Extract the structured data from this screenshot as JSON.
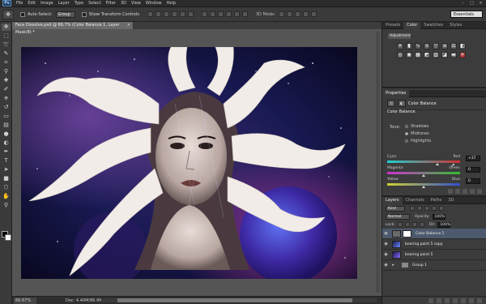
{
  "menubar": {
    "logo": "Ps",
    "items": [
      "File",
      "Edit",
      "Image",
      "Layer",
      "Type",
      "Select",
      "Filter",
      "3D",
      "View",
      "Window",
      "Help"
    ],
    "window_buttons": [
      "–",
      "□",
      "✕"
    ]
  },
  "options": {
    "auto_select_label": "Auto-Select:",
    "auto_select_value": "Group",
    "transform_label": "Show Transform Controls",
    "mode_3d_label": "3D Mode:",
    "workspace": "Essentials"
  },
  "document": {
    "tab_title": "Face Dissolve.psd @ 66.7% (Color Balance 1, Layer Mask/8) *",
    "tab_close": "×",
    "status_zoom": "66.67%",
    "status_doc": "Doc: 4.40M/86.9M",
    "status_arrow": "▸"
  },
  "panels": {
    "top_tabs": [
      "Presets",
      "Color",
      "Swatches",
      "Styles"
    ],
    "adjust_select": "Adjustment",
    "properties_tab": "Properties",
    "properties_title": "Color Balance",
    "section_label": "Color Balance",
    "tone_label": "Tone:",
    "tones": [
      {
        "label": "Shadows",
        "selected": false
      },
      {
        "label": "Midtones",
        "selected": true
      },
      {
        "label": "Highlights",
        "selected": false
      }
    ],
    "sliders": [
      {
        "left": "Cyan",
        "right": "Red",
        "value": "+37",
        "fraction": 0.69
      },
      {
        "left": "Magenta",
        "right": "Green",
        "value": "0",
        "fraction": 0.5
      },
      {
        "left": "Yellow",
        "right": "Blue",
        "value": "0",
        "fraction": 0.5
      }
    ],
    "layers_tabs": [
      "Layers",
      "Channels",
      "Paths",
      "3D"
    ],
    "kind_select": "Kind",
    "blend_mode": "Normal",
    "opacity_label": "Opacity:",
    "opacity_value": "100%",
    "lock_label": "Lock:",
    "fill_label": "Fill:",
    "fill_value": "100%",
    "layers": [
      {
        "name": "Color Balance 1",
        "type": "adjustment",
        "selected": true
      },
      {
        "name": "bearing paint 5 copy",
        "type": "image",
        "selected": false
      },
      {
        "name": "bearing paint 5",
        "type": "image",
        "selected": false
      },
      {
        "name": "Group 1",
        "type": "group",
        "selected": false
      }
    ]
  },
  "colors": {
    "selected_layer": "#4d5a6e",
    "cyan_red_track": [
      "#20d0d0",
      "#d03030"
    ],
    "magenta_green_track": [
      "#d030d0",
      "#30c030"
    ],
    "yellow_blue_track": [
      "#d0d030",
      "#3050d0"
    ]
  }
}
